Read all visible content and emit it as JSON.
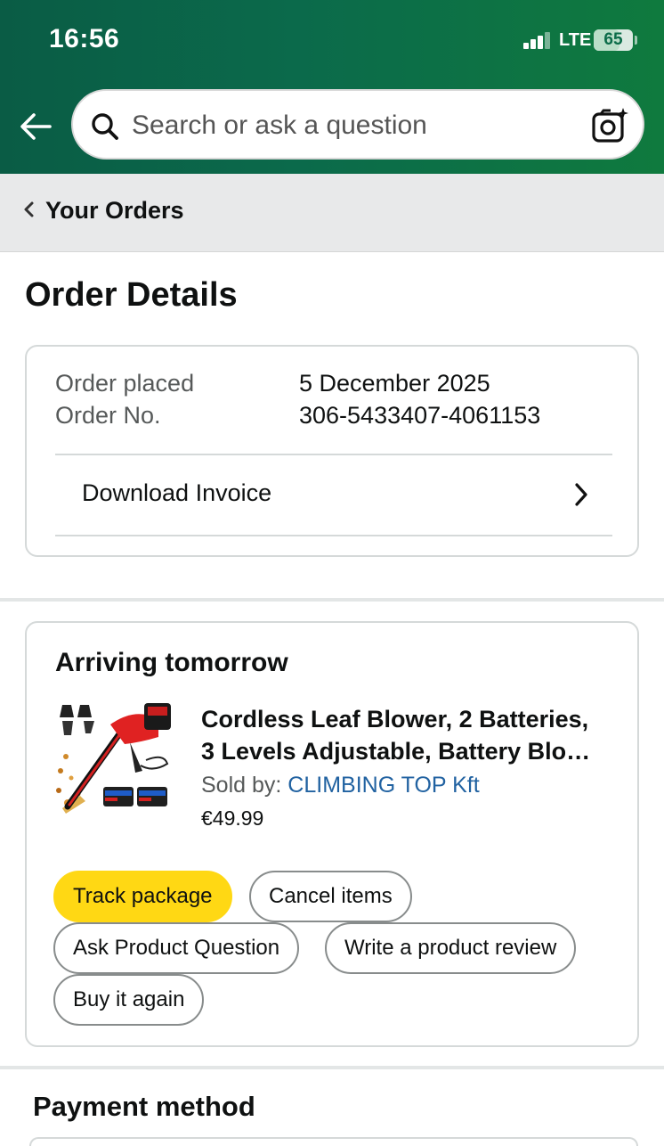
{
  "status_bar": {
    "time": "16:56",
    "network": "LTE",
    "battery": "65",
    "battery_level": 0.65
  },
  "header": {
    "search": {
      "placeholder": "Search or ask a question"
    }
  },
  "breadcrumb": {
    "label": "Your Orders"
  },
  "page": {
    "title": "Order Details"
  },
  "order": {
    "placed_label": "Order placed",
    "placed_value": "5 December 2025",
    "number_label": "Order No.",
    "number_value": "306-5433407-4061153",
    "invoice_label": "Download Invoice"
  },
  "shipment": {
    "status": "Arriving tomorrow",
    "product": {
      "title_line1": "Cordless Leaf Blower, 2 Batteries,",
      "title_line2": "3 Levels Adjustable, Battery Blo…",
      "sold_by_label": "Sold by:",
      "seller": "CLIMBING TOP Kft",
      "price": "€49.99"
    },
    "actions": {
      "track": "Track package",
      "cancel": "Cancel items",
      "ask": "Ask Product Question",
      "review": "Write a product review",
      "buy_again": "Buy it again"
    }
  },
  "payment": {
    "title": "Payment method"
  },
  "colors": {
    "header_start": "#0a5c45",
    "header_end": "#0f7a3e",
    "primary_button": "#ffd814",
    "link": "#2162a1"
  }
}
